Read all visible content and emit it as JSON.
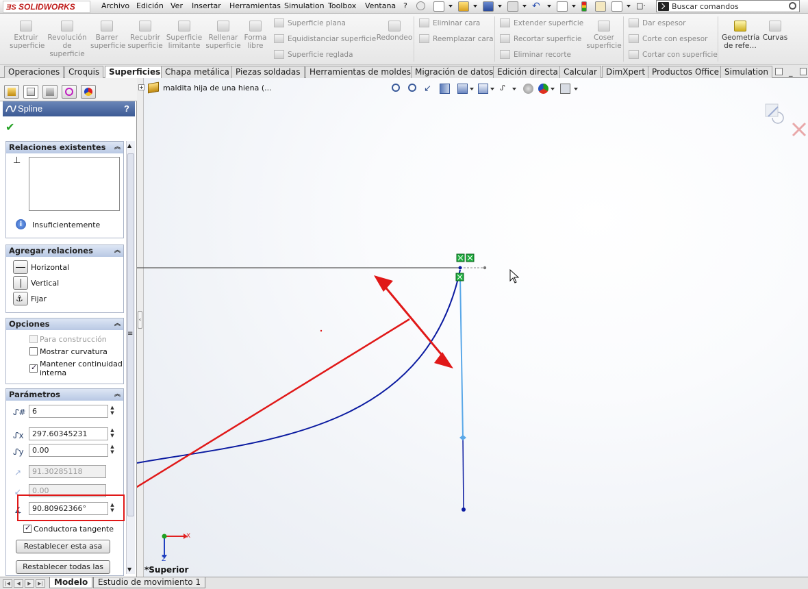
{
  "menubar": {
    "logo_prefix": "ƎS",
    "logo": "SOLIDWORKS",
    "items": [
      "Archivo",
      "Edición",
      "Ver",
      "Insertar",
      "Herramientas",
      "Simulation",
      "Toolbox",
      "Ventana",
      "?"
    ],
    "search_placeholder": "Buscar comandos"
  },
  "ribbon": {
    "big_buttons": [
      {
        "label": "Extruir\nsuperficie",
        "icon": "extrude-surface-icon"
      },
      {
        "label": "Revolución\nde\nsuperficie",
        "icon": "revolve-surface-icon"
      },
      {
        "label": "Barrer\nsuperficie",
        "icon": "sweep-surface-icon"
      },
      {
        "label": "Recubrir\nsuperficie",
        "icon": "loft-surface-icon"
      },
      {
        "label": "Superficie\nlimitante",
        "icon": "boundary-surface-icon"
      },
      {
        "label": "Rellenar\nsuperficie",
        "icon": "fill-surface-icon"
      },
      {
        "label": "Forma\nlibre",
        "icon": "freeform-icon"
      }
    ],
    "col1": [
      "Superficie plana",
      "Equidistanciar superficie",
      "Superficie reglada"
    ],
    "redondeo": "Redondeo",
    "col2": [
      "Eliminar cara",
      "Reemplazar cara"
    ],
    "col3": [
      "Extender superficie",
      "Recortar superficie",
      "Eliminar recorte"
    ],
    "coser": "Coser\nsuperficie",
    "col4": [
      "Dar espesor",
      "Corte con espesor",
      "Cortar con superficie"
    ],
    "geometria": "Geometría\nde refe…",
    "curvas": "Curvas"
  },
  "tabs": [
    "Operaciones",
    "Croquis",
    "Superficies",
    "Chapa metálica",
    "Piezas soldadas",
    "Herramientas de moldes",
    "Migración de datos",
    "Edición directa",
    "Calcular",
    "DimXpert",
    "Productos Office",
    "Simulation"
  ],
  "active_tab": "Superficies",
  "pm": {
    "title": "Spline",
    "help": "?",
    "relaciones_existentes": {
      "header": "Relaciones existentes",
      "status": "Insuficientemente"
    },
    "agregar_relaciones": {
      "header": "Agregar relaciones",
      "items": [
        "Horizontal",
        "Vertical",
        "Fijar"
      ]
    },
    "opciones": {
      "header": "Opciones",
      "para_construccion": "Para construcción",
      "mostrar_curvatura": "Mostrar curvatura",
      "mantener_continuidad": "Mantener continuidad\ninterna",
      "mantener_checked": true
    },
    "parametros": {
      "header": "Parámetros",
      "point_number": "6",
      "x": "297.60345231",
      "y": "0.00",
      "weight1": "91.30285118",
      "weight2": "0.00",
      "angle": "90.80962366°",
      "conductora_tangente": "Conductora tangente",
      "restablecer_asa": "Restablecer esta asa",
      "restablecer_todas": "Restablecer todas las asas"
    }
  },
  "viewport": {
    "tree_label": "maldita hija de una hiena  (...",
    "view_label": "*Superior",
    "axis_x": "X",
    "axis_z": "Z"
  },
  "bottom_tabs": [
    "Modelo",
    "Estudio de movimiento 1"
  ],
  "colors": {
    "spline": "#0a1aa0",
    "handle": "#5aa8e8",
    "annotation": "#e01818",
    "relation_marker": "#20b040"
  }
}
